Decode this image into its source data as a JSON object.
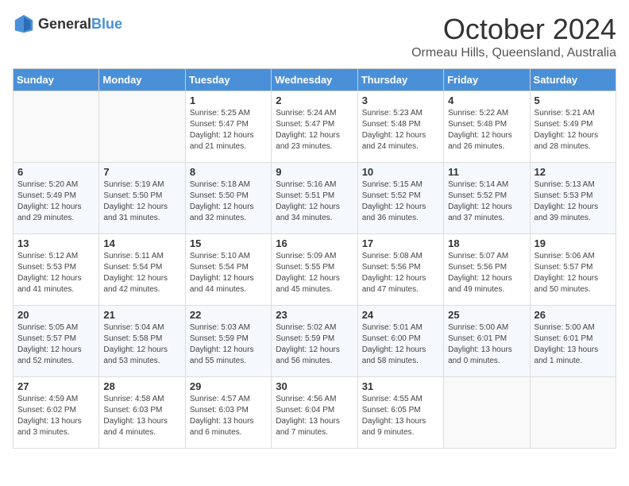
{
  "header": {
    "logo_general": "General",
    "logo_blue": "Blue",
    "month": "October 2024",
    "location": "Ormeau Hills, Queensland, Australia"
  },
  "days_of_week": [
    "Sunday",
    "Monday",
    "Tuesday",
    "Wednesday",
    "Thursday",
    "Friday",
    "Saturday"
  ],
  "weeks": [
    [
      {
        "day": "",
        "empty": true
      },
      {
        "day": "",
        "empty": true
      },
      {
        "day": "1",
        "sunrise": "Sunrise: 5:25 AM",
        "sunset": "Sunset: 5:47 PM",
        "daylight": "Daylight: 12 hours and 21 minutes."
      },
      {
        "day": "2",
        "sunrise": "Sunrise: 5:24 AM",
        "sunset": "Sunset: 5:47 PM",
        "daylight": "Daylight: 12 hours and 23 minutes."
      },
      {
        "day": "3",
        "sunrise": "Sunrise: 5:23 AM",
        "sunset": "Sunset: 5:48 PM",
        "daylight": "Daylight: 12 hours and 24 minutes."
      },
      {
        "day": "4",
        "sunrise": "Sunrise: 5:22 AM",
        "sunset": "Sunset: 5:48 PM",
        "daylight": "Daylight: 12 hours and 26 minutes."
      },
      {
        "day": "5",
        "sunrise": "Sunrise: 5:21 AM",
        "sunset": "Sunset: 5:49 PM",
        "daylight": "Daylight: 12 hours and 28 minutes."
      }
    ],
    [
      {
        "day": "6",
        "sunrise": "Sunrise: 5:20 AM",
        "sunset": "Sunset: 5:49 PM",
        "daylight": "Daylight: 12 hours and 29 minutes."
      },
      {
        "day": "7",
        "sunrise": "Sunrise: 5:19 AM",
        "sunset": "Sunset: 5:50 PM",
        "daylight": "Daylight: 12 hours and 31 minutes."
      },
      {
        "day": "8",
        "sunrise": "Sunrise: 5:18 AM",
        "sunset": "Sunset: 5:50 PM",
        "daylight": "Daylight: 12 hours and 32 minutes."
      },
      {
        "day": "9",
        "sunrise": "Sunrise: 5:16 AM",
        "sunset": "Sunset: 5:51 PM",
        "daylight": "Daylight: 12 hours and 34 minutes."
      },
      {
        "day": "10",
        "sunrise": "Sunrise: 5:15 AM",
        "sunset": "Sunset: 5:52 PM",
        "daylight": "Daylight: 12 hours and 36 minutes."
      },
      {
        "day": "11",
        "sunrise": "Sunrise: 5:14 AM",
        "sunset": "Sunset: 5:52 PM",
        "daylight": "Daylight: 12 hours and 37 minutes."
      },
      {
        "day": "12",
        "sunrise": "Sunrise: 5:13 AM",
        "sunset": "Sunset: 5:53 PM",
        "daylight": "Daylight: 12 hours and 39 minutes."
      }
    ],
    [
      {
        "day": "13",
        "sunrise": "Sunrise: 5:12 AM",
        "sunset": "Sunset: 5:53 PM",
        "daylight": "Daylight: 12 hours and 41 minutes."
      },
      {
        "day": "14",
        "sunrise": "Sunrise: 5:11 AM",
        "sunset": "Sunset: 5:54 PM",
        "daylight": "Daylight: 12 hours and 42 minutes."
      },
      {
        "day": "15",
        "sunrise": "Sunrise: 5:10 AM",
        "sunset": "Sunset: 5:54 PM",
        "daylight": "Daylight: 12 hours and 44 minutes."
      },
      {
        "day": "16",
        "sunrise": "Sunrise: 5:09 AM",
        "sunset": "Sunset: 5:55 PM",
        "daylight": "Daylight: 12 hours and 45 minutes."
      },
      {
        "day": "17",
        "sunrise": "Sunrise: 5:08 AM",
        "sunset": "Sunset: 5:56 PM",
        "daylight": "Daylight: 12 hours and 47 minutes."
      },
      {
        "day": "18",
        "sunrise": "Sunrise: 5:07 AM",
        "sunset": "Sunset: 5:56 PM",
        "daylight": "Daylight: 12 hours and 49 minutes."
      },
      {
        "day": "19",
        "sunrise": "Sunrise: 5:06 AM",
        "sunset": "Sunset: 5:57 PM",
        "daylight": "Daylight: 12 hours and 50 minutes."
      }
    ],
    [
      {
        "day": "20",
        "sunrise": "Sunrise: 5:05 AM",
        "sunset": "Sunset: 5:57 PM",
        "daylight": "Daylight: 12 hours and 52 minutes."
      },
      {
        "day": "21",
        "sunrise": "Sunrise: 5:04 AM",
        "sunset": "Sunset: 5:58 PM",
        "daylight": "Daylight: 12 hours and 53 minutes."
      },
      {
        "day": "22",
        "sunrise": "Sunrise: 5:03 AM",
        "sunset": "Sunset: 5:59 PM",
        "daylight": "Daylight: 12 hours and 55 minutes."
      },
      {
        "day": "23",
        "sunrise": "Sunrise: 5:02 AM",
        "sunset": "Sunset: 5:59 PM",
        "daylight": "Daylight: 12 hours and 56 minutes."
      },
      {
        "day": "24",
        "sunrise": "Sunrise: 5:01 AM",
        "sunset": "Sunset: 6:00 PM",
        "daylight": "Daylight: 12 hours and 58 minutes."
      },
      {
        "day": "25",
        "sunrise": "Sunrise: 5:00 AM",
        "sunset": "Sunset: 6:01 PM",
        "daylight": "Daylight: 13 hours and 0 minutes."
      },
      {
        "day": "26",
        "sunrise": "Sunrise: 5:00 AM",
        "sunset": "Sunset: 6:01 PM",
        "daylight": "Daylight: 13 hours and 1 minute."
      }
    ],
    [
      {
        "day": "27",
        "sunrise": "Sunrise: 4:59 AM",
        "sunset": "Sunset: 6:02 PM",
        "daylight": "Daylight: 13 hours and 3 minutes."
      },
      {
        "day": "28",
        "sunrise": "Sunrise: 4:58 AM",
        "sunset": "Sunset: 6:03 PM",
        "daylight": "Daylight: 13 hours and 4 minutes."
      },
      {
        "day": "29",
        "sunrise": "Sunrise: 4:57 AM",
        "sunset": "Sunset: 6:03 PM",
        "daylight": "Daylight: 13 hours and 6 minutes."
      },
      {
        "day": "30",
        "sunrise": "Sunrise: 4:56 AM",
        "sunset": "Sunset: 6:04 PM",
        "daylight": "Daylight: 13 hours and 7 minutes."
      },
      {
        "day": "31",
        "sunrise": "Sunrise: 4:55 AM",
        "sunset": "Sunset: 6:05 PM",
        "daylight": "Daylight: 13 hours and 9 minutes."
      },
      {
        "day": "",
        "empty": true
      },
      {
        "day": "",
        "empty": true
      }
    ]
  ]
}
